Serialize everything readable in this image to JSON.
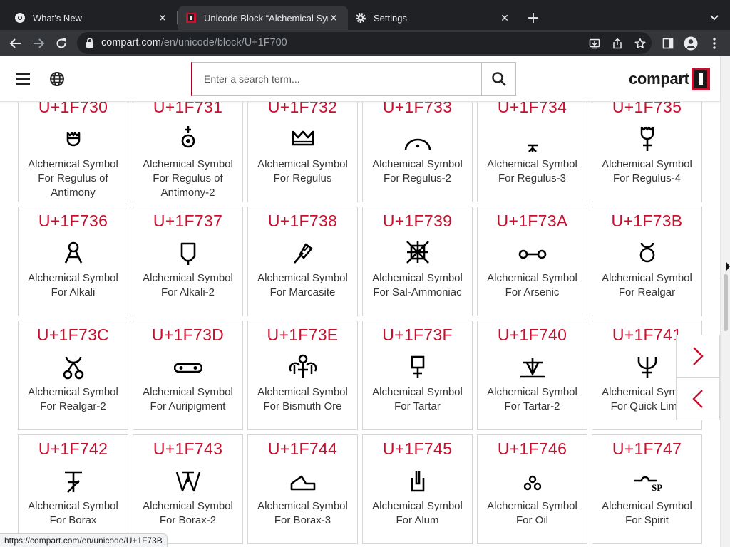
{
  "browser": {
    "tabs": [
      {
        "title": "What's New",
        "icon": "chrome-icon",
        "active": false
      },
      {
        "title": "Unicode Block “Alchemical Symbols”",
        "icon": "compart-favicon",
        "active": true
      },
      {
        "title": "Settings",
        "icon": "gear-icon",
        "active": false
      }
    ],
    "url_host": "compart.com",
    "url_path": "/en/unicode/block/U+1F700"
  },
  "site": {
    "logo_text": "compart",
    "search_placeholder": "Enter a search term..."
  },
  "cards": [
    {
      "code": "U+1F730",
      "name": "Alchemical Symbol For Regulus of Antimony",
      "icon": "regulus-of-antimony-glyph"
    },
    {
      "code": "U+1F731",
      "name": "Alchemical Symbol For Regulus of Antimony-2",
      "icon": "regulus-of-antimony-2-glyph"
    },
    {
      "code": "U+1F732",
      "name": "Alchemical Symbol For Regulus",
      "icon": "regulus-glyph"
    },
    {
      "code": "U+1F733",
      "name": "Alchemical Symbol For Regulus-2",
      "icon": "regulus-2-glyph"
    },
    {
      "code": "U+1F734",
      "name": "Alchemical Symbol For Regulus-3",
      "icon": "regulus-3-glyph"
    },
    {
      "code": "U+1F735",
      "name": "Alchemical Symbol For Regulus-4",
      "icon": "regulus-4-glyph"
    },
    {
      "code": "U+1F736",
      "name": "Alchemical Symbol For Alkali",
      "icon": "alkali-glyph"
    },
    {
      "code": "U+1F737",
      "name": "Alchemical Symbol For Alkali-2",
      "icon": "alkali-2-glyph"
    },
    {
      "code": "U+1F738",
      "name": "Alchemical Symbol For Marcasite",
      "icon": "marcasite-glyph"
    },
    {
      "code": "U+1F739",
      "name": "Alchemical Symbol For Sal-Ammoniac",
      "icon": "sal-ammoniac-glyph"
    },
    {
      "code": "U+1F73A",
      "name": "Alchemical Symbol For Arsenic",
      "icon": "arsenic-glyph"
    },
    {
      "code": "U+1F73B",
      "name": "Alchemical Symbol For Realgar",
      "icon": "realgar-glyph"
    },
    {
      "code": "U+1F73C",
      "name": "Alchemical Symbol For Realgar-2",
      "icon": "realgar-2-glyph"
    },
    {
      "code": "U+1F73D",
      "name": "Alchemical Symbol For Auripigment",
      "icon": "auripigment-glyph"
    },
    {
      "code": "U+1F73E",
      "name": "Alchemical Symbol For Bismuth Ore",
      "icon": "bismuth-ore-glyph"
    },
    {
      "code": "U+1F73F",
      "name": "Alchemical Symbol For Tartar",
      "icon": "tartar-glyph"
    },
    {
      "code": "U+1F740",
      "name": "Alchemical Symbol For Tartar-2",
      "icon": "tartar-2-glyph"
    },
    {
      "code": "U+1F741",
      "name": "Alchemical Symbol For Quick Lime",
      "icon": "quick-lime-glyph"
    },
    {
      "code": "U+1F742",
      "name": "Alchemical Symbol For Borax",
      "icon": "borax-glyph"
    },
    {
      "code": "U+1F743",
      "name": "Alchemical Symbol For Borax-2",
      "icon": "borax-2-glyph"
    },
    {
      "code": "U+1F744",
      "name": "Alchemical Symbol For Borax-3",
      "icon": "borax-3-glyph"
    },
    {
      "code": "U+1F745",
      "name": "Alchemical Symbol For Alum",
      "icon": "alum-glyph"
    },
    {
      "code": "U+1F746",
      "name": "Alchemical Symbol For Oil",
      "icon": "oil-glyph"
    },
    {
      "code": "U+1F747",
      "name": "Alchemical Symbol For Spirit",
      "icon": "spirit-glyph"
    }
  ],
  "status_url": "https://compart.com/en/unicode/U+1F73B",
  "colors": {
    "accent": "#c8102e",
    "chrome_dark": "#202124",
    "chrome_toolbar": "#35363a"
  }
}
